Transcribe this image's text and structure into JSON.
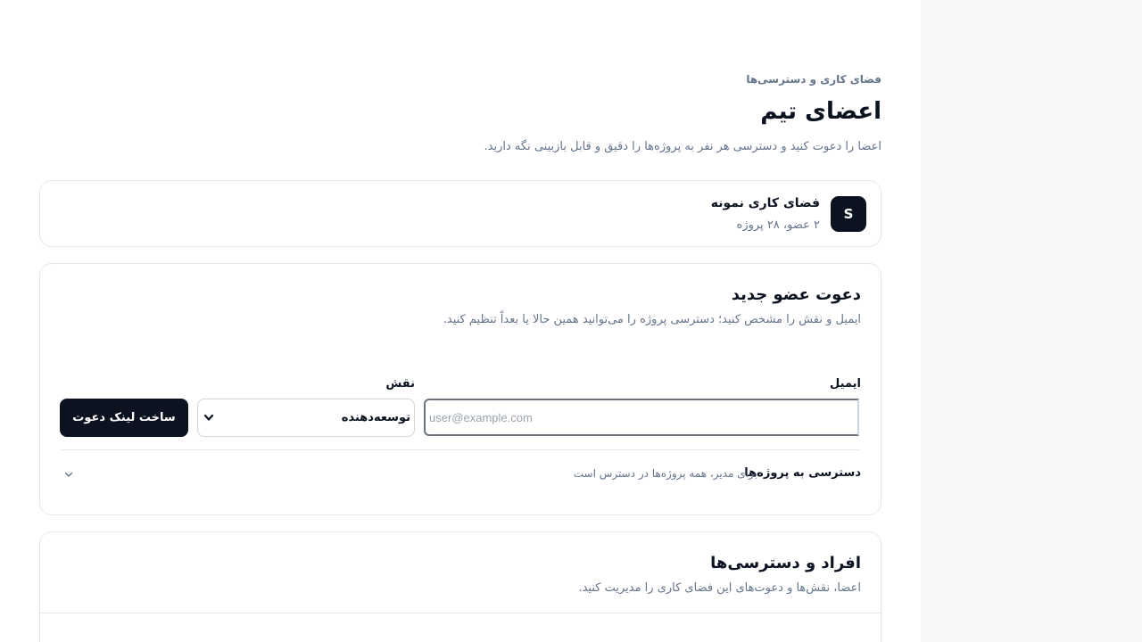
{
  "header": {
    "breadcrumb": "فضای کاری و دسترسی‌ها",
    "title": "اعضای تیم",
    "subtitle": "اعضا را دعوت کنید و دسترسی هر نفر به پروژه‌ها را دقیق و قابل بازبینی نگه دارید."
  },
  "workspace": {
    "avatar_letter": "S",
    "name": "فضای کاری نمونه",
    "meta": "۲ عضو، ۲۸ پروژه"
  },
  "invite": {
    "title": "دعوت عضو جدید",
    "subtitle": "ایمیل و نقش را مشخص کنید؛ دسترسی پروژه را می‌توانید همین حالا یا بعداً تنظیم کنید.",
    "email_label": "ایمیل",
    "email_placeholder": "user@example.com",
    "email_value": "",
    "role_label": "نقش",
    "role_value": "توسعه‌دهنده",
    "submit_label": "ساخت لینک دعوت",
    "access_label": "دسترسی به پروژه‌ها",
    "access_hint": "برای مدیر، همه پروژه‌ها در دسترس است"
  },
  "members": {
    "title": "افراد و دسترسی‌ها",
    "subtitle": "اعضا، نقش‌ها و دعوت‌های این فضای کاری را مدیریت کنید."
  },
  "colors": {
    "primary": "#0b1220",
    "muted_text": "#64748b",
    "border": "#e5e7eb",
    "side_panel": "#f6f7f9"
  }
}
